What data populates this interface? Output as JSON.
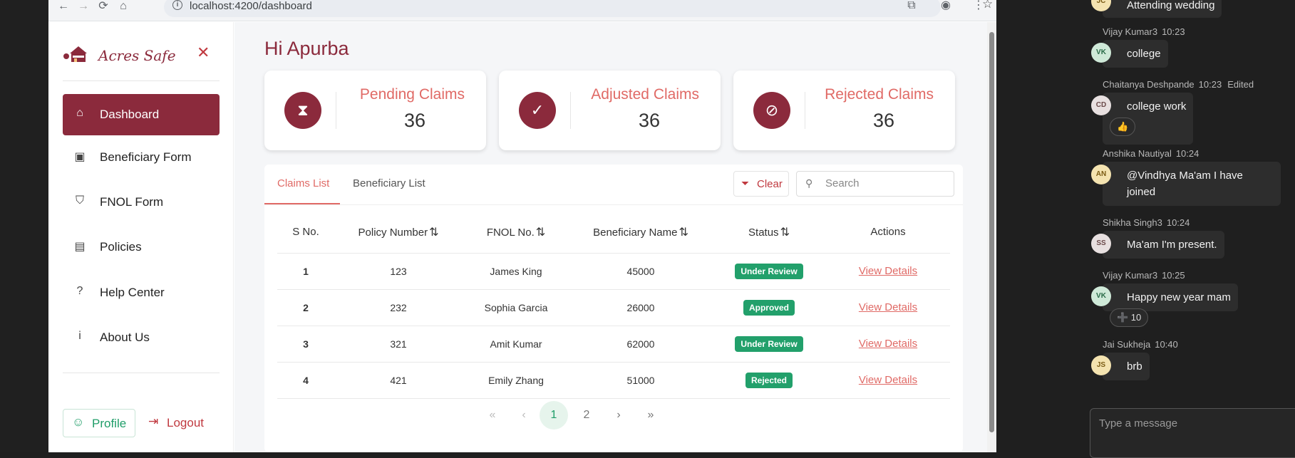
{
  "browser": {
    "url": "localhost:4200/dashboard"
  },
  "sidebar": {
    "brand": "Acres Safe",
    "items": [
      {
        "label": "Dashboard",
        "icon": "home-icon"
      },
      {
        "label": "Beneficiary Form",
        "icon": "contact-card-icon"
      },
      {
        "label": "FNOL Form",
        "icon": "shield-icon"
      },
      {
        "label": "Policies",
        "icon": "document-icon"
      },
      {
        "label": "Help Center",
        "icon": "question-circle-icon"
      },
      {
        "label": "About Us",
        "icon": "info-icon"
      }
    ],
    "profile_label": "Profile",
    "logout_label": "Logout"
  },
  "main": {
    "greeting": "Hi Apurba",
    "cards": [
      {
        "title": "Pending Claims",
        "count": "36",
        "icon": "hourglass-icon"
      },
      {
        "title": "Adjusted Claims",
        "count": "36",
        "icon": "check-icon"
      },
      {
        "title": "Rejected Claims",
        "count": "36",
        "icon": "ban-icon"
      }
    ],
    "tabs": [
      "Claims List",
      "Beneficiary List"
    ],
    "clear_label": "Clear",
    "search_placeholder": "Search",
    "columns": [
      "S No.",
      "Policy Number",
      "FNOL No.",
      "Beneficiary Name",
      "Status",
      "Actions"
    ],
    "rows": [
      {
        "sno": "1",
        "policy": "123",
        "fnol": "James King",
        "beneficiary": "45000",
        "status": "Under Review",
        "action": "View Details"
      },
      {
        "sno": "2",
        "policy": "232",
        "fnol": "Sophia Garcia",
        "beneficiary": "26000",
        "status": "Approved",
        "action": "View Details"
      },
      {
        "sno": "3",
        "policy": "321",
        "fnol": "Amit Kumar",
        "beneficiary": "62000",
        "status": "Under Review",
        "action": "View Details"
      },
      {
        "sno": "4",
        "policy": "421",
        "fnol": "Emily Zhang",
        "beneficiary": "51000",
        "status": "Rejected",
        "action": "View Details"
      }
    ],
    "pagination": {
      "first": "«",
      "prev": "‹",
      "pages": [
        "1",
        "2"
      ],
      "current": "1",
      "next": "›",
      "last": "»"
    }
  },
  "chat": {
    "top_partial": "Attending wedding",
    "messages": [
      {
        "author": "Vijay Kumar3",
        "time": "10:23",
        "initials": "VK",
        "text": "college",
        "avatar_color": "#cfe9d8"
      },
      {
        "author": "Chaitanya Deshpande",
        "time": "10:23",
        "edited": "Edited",
        "initials": "CD",
        "text": "college work",
        "reaction": "👍",
        "avatar_color": "#e8e0e0"
      },
      {
        "author": "Anshika Nautiyal",
        "time": "10:24",
        "initials": "AN",
        "text": "@Vindhya Ma'am I have joined",
        "avatar_color": "#f4e3b0"
      },
      {
        "author": "Shikha Singh3",
        "time": "10:24",
        "initials": "SS",
        "text": "Ma'am I'm present.",
        "avatar_color": "#e8e0e0"
      },
      {
        "author": "Vijay Kumar3",
        "time": "10:25",
        "initials": "VK",
        "text": "Happy new year mam",
        "reaction": "➕ 10",
        "avatar_color": "#cfe9d8"
      },
      {
        "author": "Jai Sukheja",
        "time": "10:40",
        "initials": "JS",
        "text": "brb",
        "avatar_color": "#f4e3b0"
      }
    ],
    "composer_placeholder": "Type a message"
  }
}
